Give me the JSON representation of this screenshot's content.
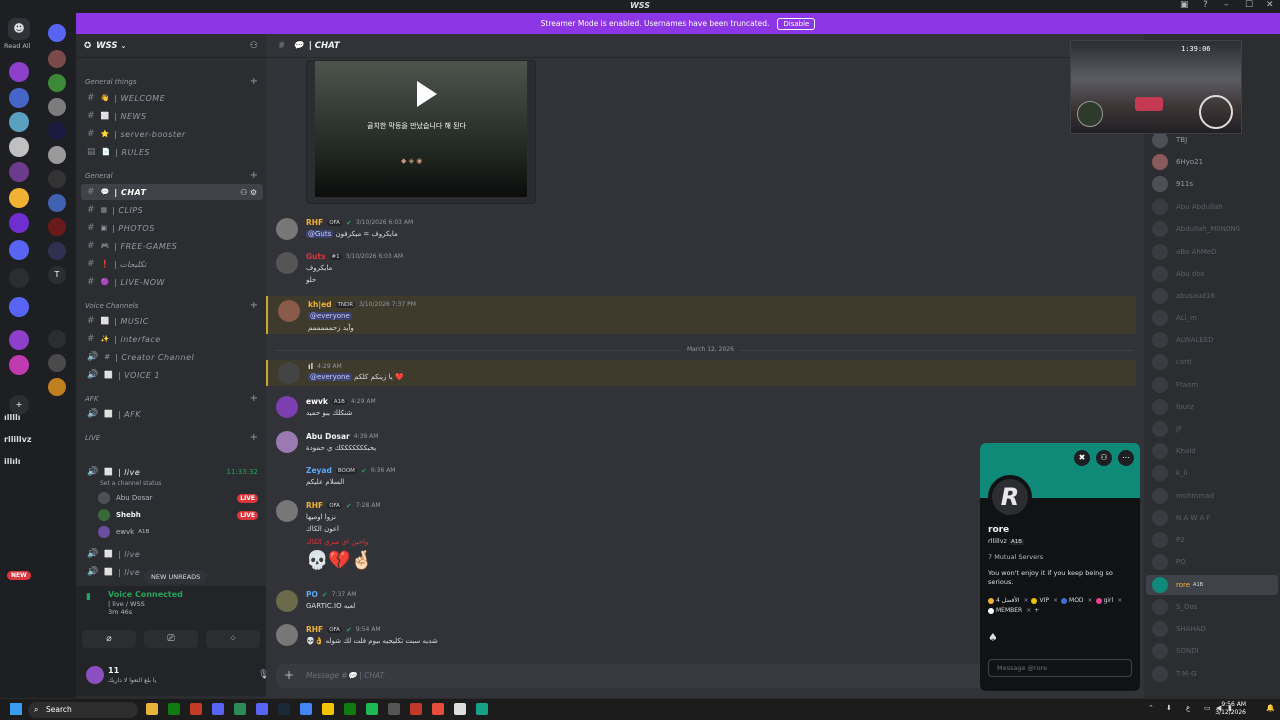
{
  "window": {
    "title": "WSS",
    "minimize": "–",
    "maximize": "☐",
    "close": "✕"
  },
  "banner": {
    "text": "Streamer Mode is enabled. Usernames have been truncated.",
    "button": "Disable"
  },
  "rail": {
    "read_all": "Read All"
  },
  "guild": {
    "name": "WSS"
  },
  "categories": [
    {
      "label": "General things"
    },
    {
      "label": "General"
    },
    {
      "label": "Voice Channels"
    },
    {
      "label": "AFK"
    },
    {
      "label": "LIVE"
    }
  ],
  "channels": {
    "welcome": "| WELCOME",
    "news": "| NEWS",
    "booster": "| server-booster",
    "rules": "| RULES",
    "chat": "| CHAT",
    "clips": "| CLIPS",
    "photos": "| PHOTOS",
    "free_games": "| FREE-GAMES",
    "arabic": "| تكليجات",
    "live_now": "| LIVE-NOW",
    "music": "| MUSIC",
    "interface": "| interface",
    "creator": "| Creator Channel",
    "voice1": "| VOICE 1",
    "afk": "| AFK",
    "live1": "| live",
    "live2": "| live",
    "live3": "| live"
  },
  "live_channel": {
    "status": "Set a channel status",
    "timer": "11:33:32"
  },
  "live_users": [
    {
      "name": "Abu Dosar",
      "badge": "LIVE"
    },
    {
      "name": "Shebh",
      "badge": "LIVE"
    },
    {
      "name": "ewvk",
      "tag": "A1B"
    }
  ],
  "new_unreads": "NEW UNREADS",
  "new_badge": "NEW",
  "voice_panel": {
    "title": "Voice Connected",
    "channel": "| live / WSS",
    "time": "3m 46s"
  },
  "user_panel": {
    "name": "11",
    "status": "يا بلغ النعوا لا داريك"
  },
  "chat": {
    "channel": "| CHAT",
    "video_text": "골치한 막등을 만났습니다 해 된다",
    "date_divider": "March 12, 2026",
    "composer_placeholder": "Message #💬 | CHAT"
  },
  "messages": [
    {
      "author": "RHF",
      "tag": "OFA",
      "time": "3/10/2026 6:03 AM",
      "mention": "@Guts",
      "text": "مايكروف = ميكرفون",
      "color": "#f0b232"
    },
    {
      "author": "Guts",
      "tag": "#1",
      "time": "3/10/2026 6:03 AM",
      "line1": "مايكروف",
      "line2": "حلو",
      "color": "#da373c"
    },
    {
      "author": "kh|ed",
      "tag": "TNDR",
      "time": "3/10/2026 7:37 PM",
      "mention": "@everyone",
      "text": "وآيد زحمممممم",
      "color": "#f0b232"
    },
    {
      "author": "ıl",
      "time": "4:29 AM",
      "mention": "@everyone",
      "text": "يا زينكم كلكم ❤️"
    },
    {
      "author": "ewvk",
      "tag": "A1B",
      "time": "4:29 AM",
      "text": "شنكلك يبو حميد",
      "color": "#ffffff"
    },
    {
      "author": "Abu Dosar",
      "time": "4:39 AM",
      "text": "يحبكككككككك ي حمودة",
      "color": "#f2f3f5"
    },
    {
      "author": "Zeyad",
      "tag": "BOOM",
      "time": "6:36 AM",
      "text": "السلام عليكم",
      "color": "#5ba7f5"
    },
    {
      "author": "RHF",
      "tag": "OFA",
      "time": "7:28 AM",
      "line1": "نزوا اوميها",
      "line2": "اعون الكاك",
      "line3": "واحين اي سري الكاك",
      "emoji": "💀💔🤞🏻",
      "color": "#f0b232"
    },
    {
      "author": "PO",
      "time": "7:37 AM",
      "text": "GARTIC.IO لعبه",
      "color": "#5ba7f5"
    },
    {
      "author": "RHF",
      "tag": "OFA",
      "time": "9:54 AM",
      "text": "💀👌 شديه سبت تكليجيه بيوم فلت لك شوله",
      "color": "#f0b232"
    }
  ],
  "members": [
    {
      "name": "TBJ"
    },
    {
      "name": "6Hyo21"
    },
    {
      "name": "911s"
    },
    {
      "name": "Abu Abdullah"
    },
    {
      "name": "Abdullah_M0N0N0"
    },
    {
      "name": "aBo AhMeD"
    },
    {
      "name": "Abu dos"
    },
    {
      "name": "abusaud16"
    },
    {
      "name": "ALi_m"
    },
    {
      "name": "ALWALEED"
    },
    {
      "name": "carti"
    },
    {
      "name": "Ftaom"
    },
    {
      "name": "fourz"
    },
    {
      "name": "JF"
    },
    {
      "name": "Khald"
    },
    {
      "name": "k_li"
    },
    {
      "name": "mohmmad"
    },
    {
      "name": "N A W A F"
    },
    {
      "name": "P2"
    },
    {
      "name": "PO"
    },
    {
      "name": "rore",
      "tag": "A1B"
    },
    {
      "name": "S_Oos"
    },
    {
      "name": "SHAHAD"
    },
    {
      "name": "SONDI"
    },
    {
      "name": "T-M-G"
    }
  ],
  "stream_overlay": {
    "clock": "1:39:06"
  },
  "profile": {
    "display_name": "rore",
    "username": "rllillvz",
    "tag": "A1B",
    "mutual": "7 Mutual Servers",
    "bio": "You won't enjoy it if you keep being so serious.",
    "roles": [
      {
        "name": "الأفضل 4",
        "color": "#f0b232"
      },
      {
        "name": "VIP",
        "color": "#f0c400"
      },
      {
        "name": "MOD",
        "color": "#3e70dd"
      },
      {
        "name": "girl",
        "color": "#eb459e"
      },
      {
        "name": "MEMBER",
        "color": "#ffffff"
      }
    ],
    "message_placeholder": "Message @rore"
  },
  "taskbar": {
    "search": "Search",
    "time": "9:56 AM",
    "date": "3/12/2026"
  }
}
